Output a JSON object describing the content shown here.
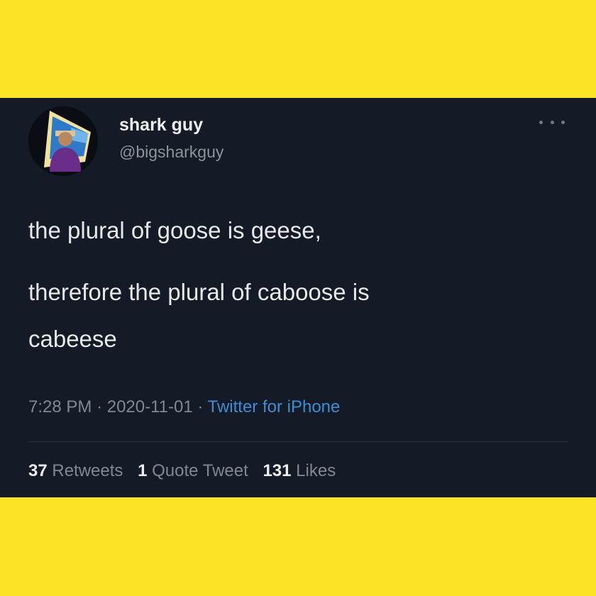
{
  "tweet": {
    "display_name": "shark guy",
    "handle": "@bigsharkguy",
    "text_lines": [
      "the plural of goose is geese,",
      "therefore the plural of caboose is",
      "cabeese"
    ],
    "time": "7:28 PM",
    "date": "2020-11-01",
    "separator": "·",
    "source": "Twitter for iPhone",
    "stats": {
      "retweets_count": "37",
      "retweets_label": "Retweets",
      "quotes_count": "1",
      "quotes_label": "Quote Tweet",
      "likes_count": "131",
      "likes_label": "Likes"
    }
  },
  "colors": {
    "page_background": "#fbe425",
    "card_background": "#151a27",
    "link_blue": "#3b8ed4"
  },
  "icons": {
    "more": "more-options-icon",
    "avatar": "avatar"
  }
}
